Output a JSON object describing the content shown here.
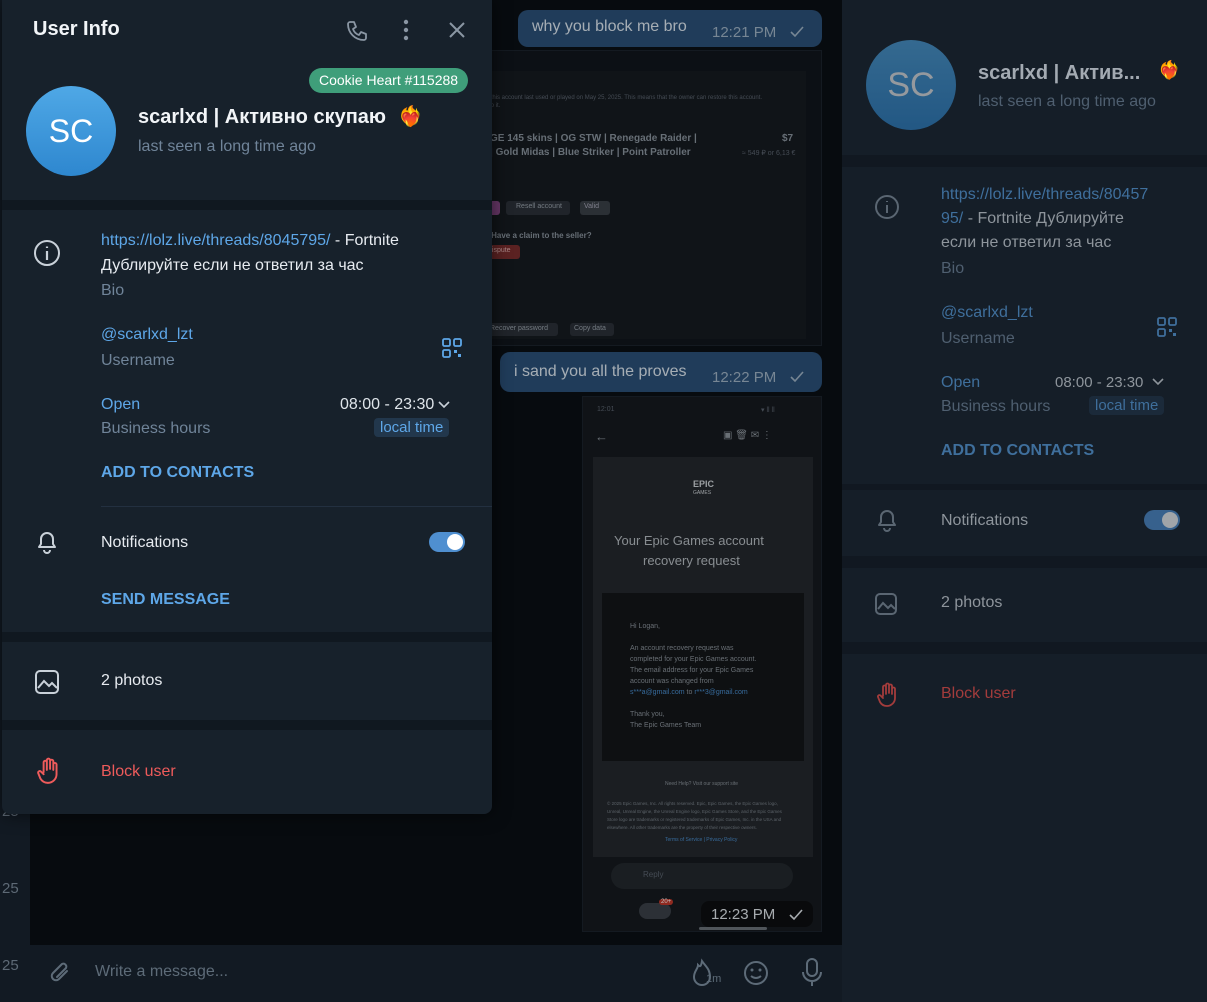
{
  "modal": {
    "title": "User Info",
    "badge": "Cookie Heart #115288",
    "avatar_initials": "SC",
    "name": "scarlxd | Активно скупаю",
    "status": "last seen a long time ago",
    "bio_link": "https://lolz.live/threads/8045795/",
    "bio_text_1": " - Fortnite",
    "bio_text_2": "Дублируйте если не ответил за час",
    "bio_label": "Bio",
    "username": "@scarlxd_lzt",
    "username_label": "Username",
    "open_label": "Open",
    "business_hours_label": "Business hours",
    "hours": "08:00 - 23:30",
    "local_time": "local time",
    "add_to_contacts": "ADD TO CONTACTS",
    "notifications": "Notifications",
    "send_message": "SEND MESSAGE",
    "photos": "2 photos",
    "block_user": "Block user"
  },
  "right_panel": {
    "avatar_initials": "SC",
    "name": "scarlxd | Актив...",
    "status": "last seen a long time ago",
    "bio_link_1": "https://lolz.live/threads/80457",
    "bio_link_2": "95/",
    "bio_text_1": " - Fortnite Дублируйте",
    "bio_text_2": "если не ответил за час",
    "bio_label": "Bio",
    "username": "@scarlxd_lzt",
    "username_label": "Username",
    "open_label": "Open",
    "hours": "08:00 - 23:30",
    "business_hours_label": "Business hours",
    "local_time": "local time",
    "add_to_contacts": "ADD TO CONTACTS",
    "notifications": "Notifications",
    "photos": "2 photos",
    "block_user": "Block user"
  },
  "chat": {
    "messages": [
      {
        "text": "why you block me bro",
        "time": "12:21 PM"
      },
      {
        "text": "i sand you all the proves",
        "time": "12:22 PM"
      },
      {
        "text": "",
        "time": "12:23 PM"
      }
    ],
    "composer_placeholder": "Write a message...",
    "composer_timer": "1m"
  },
  "side_strip": {
    "numbers": [
      "25",
      "25",
      "25"
    ]
  },
  "screenshot1": {
    "line1": "of this account last used or played on May 25, 2025. This means that the owner can restore this account.",
    "line2": "d to it.",
    "title1": "GE 145 skins | OG STW | Renegade Raider |",
    "title2": "| Gold Midas | Blue Striker | Point Patroller",
    "price": "$7",
    "price_sub": "≈ 549 ₽ or 6,13 €",
    "resell": "Resell account",
    "valid": "Valid",
    "claim": "? Have a claim to the seller?",
    "dispute": "dispute",
    "recover": "Recover password",
    "copy": "Copy data"
  },
  "screenshot2": {
    "status_time": "12:01",
    "signal": "▾ ll ll",
    "epic": "EPIC",
    "games": "GAMES",
    "heading1": "Your Epic Games account",
    "heading2": "recovery request",
    "greeting": "Hi Logan,",
    "body1": "An account recovery request was",
    "body2": "completed for your Epic Games account.",
    "body3": "The email address for your Epic Games",
    "body4": "account was changed from",
    "body5a": "s***a@gmail.com",
    "body5b": " to ",
    "body5c": "r***3@gmail.com",
    "thanks1": "Thank you,",
    "thanks2": "The Epic Games Team",
    "need_help": "Need Help? Visit our support site",
    "legal1": "© 2025 Epic Games, Inc. All rights reserved. Epic, Epic Games, the Epic Games logo,",
    "legal2": "Unreal, Unreal Engine, the Unreal Engine logo, Epic Games Store, and the Epic Games",
    "legal3": "Store logo are trademarks or registered trademarks of Epic Games, Inc. in the USA and",
    "legal4": "elsewhere. All other trademarks are the property of their respective owners.",
    "legal5": "Terms of Service | Privacy Policy",
    "reply": "Reply",
    "mail_badge": "20+"
  },
  "colors": {
    "accent": "#5ea7e8",
    "danger": "#ee5b5b",
    "badge": "#3f9e7a",
    "modal_bg": "#17212b"
  }
}
